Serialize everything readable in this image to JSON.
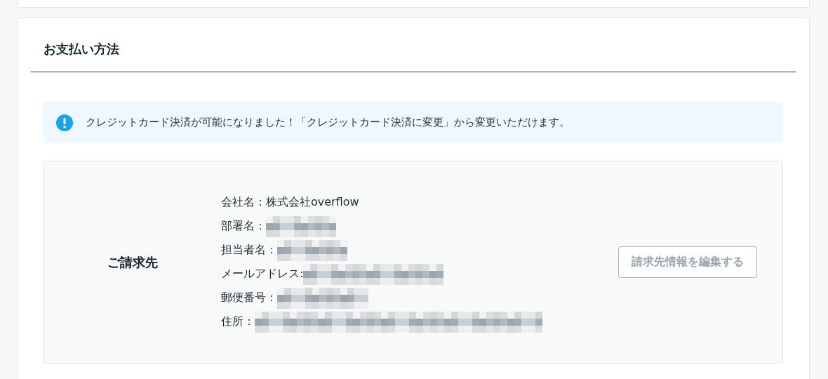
{
  "section": {
    "title": "お支払い方法"
  },
  "notice": {
    "text": "クレジットカード決済が可能になりました！「クレジットカード決済に変更」から変更いただけます。"
  },
  "billing": {
    "heading": "ご請求先",
    "fields": [
      {
        "label": "会社名：",
        "value": "株式会社overflow",
        "redacted": false
      },
      {
        "label": "部署名：",
        "redacted": true
      },
      {
        "label": "担当者名：",
        "redacted": true
      },
      {
        "label": "メールアドレス:",
        "redacted": true
      },
      {
        "label": "郵便番号：",
        "redacted": true
      },
      {
        "label": "住所：",
        "redacted": true
      }
    ],
    "edit_button": {
      "label": "請求先情報を編集する",
      "disabled": true
    }
  }
}
